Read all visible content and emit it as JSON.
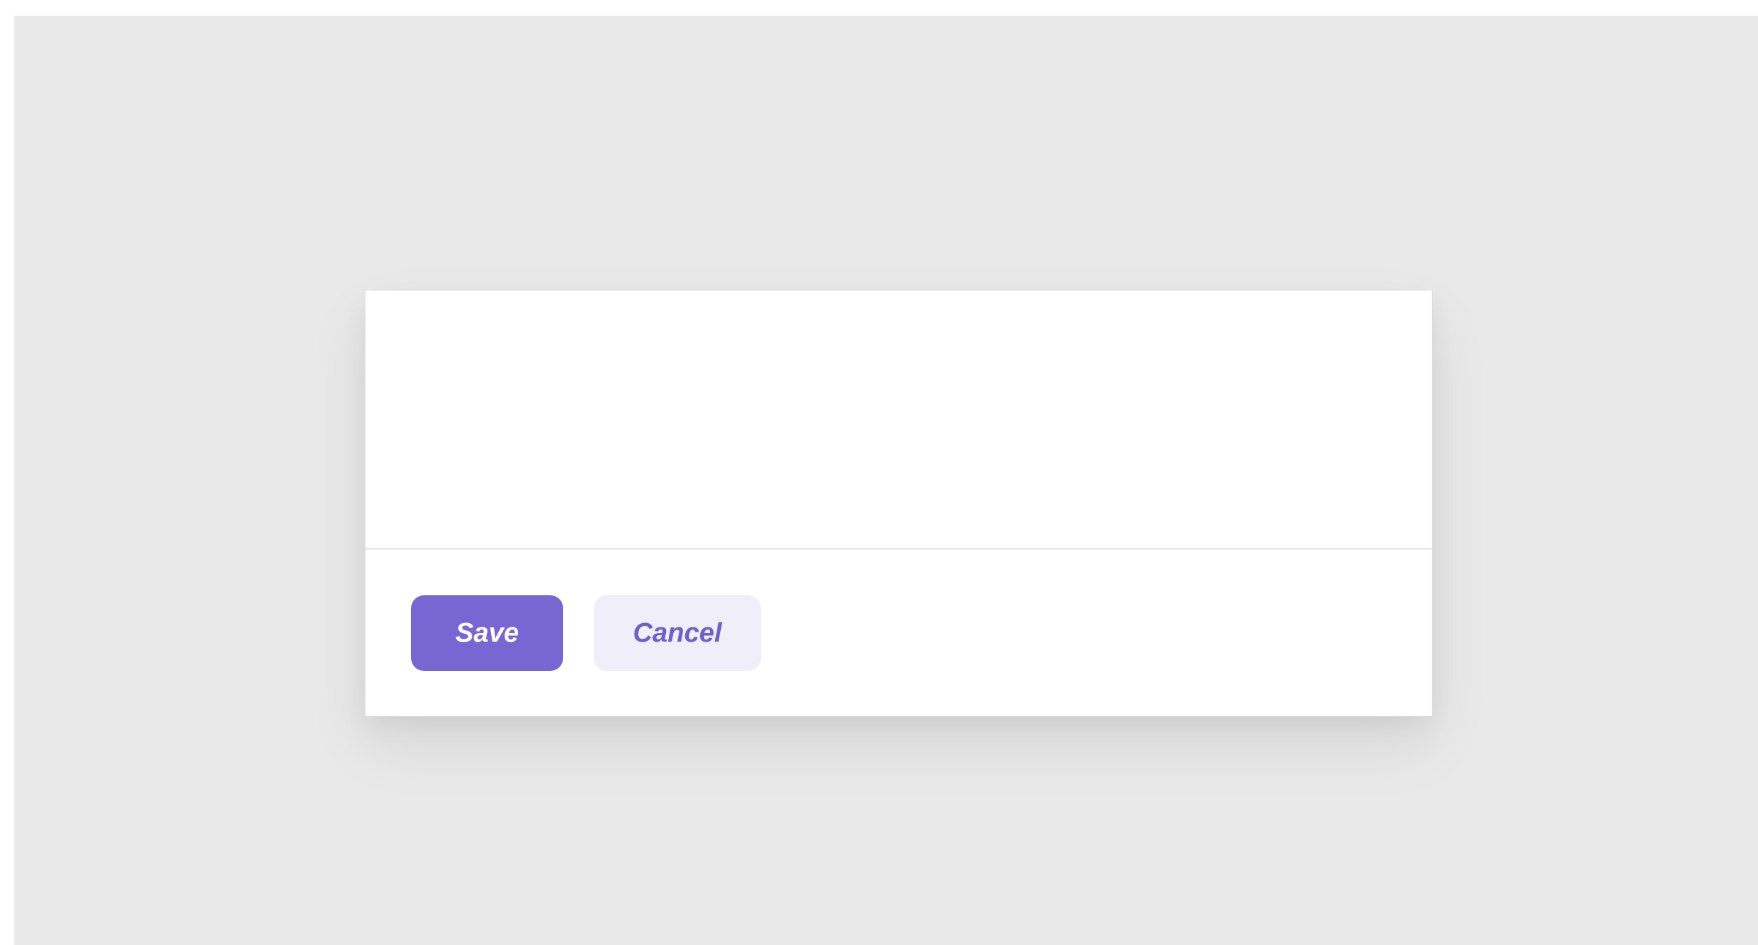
{
  "dialog": {
    "actions": {
      "save_label": "Save",
      "cancel_label": "Cancel"
    }
  },
  "colors": {
    "accent": "#7867d3",
    "secondary_bg": "#efeef9",
    "secondary_text": "#6f5fc6",
    "backdrop": "#e8e9e8",
    "surface": "#ffffff"
  }
}
